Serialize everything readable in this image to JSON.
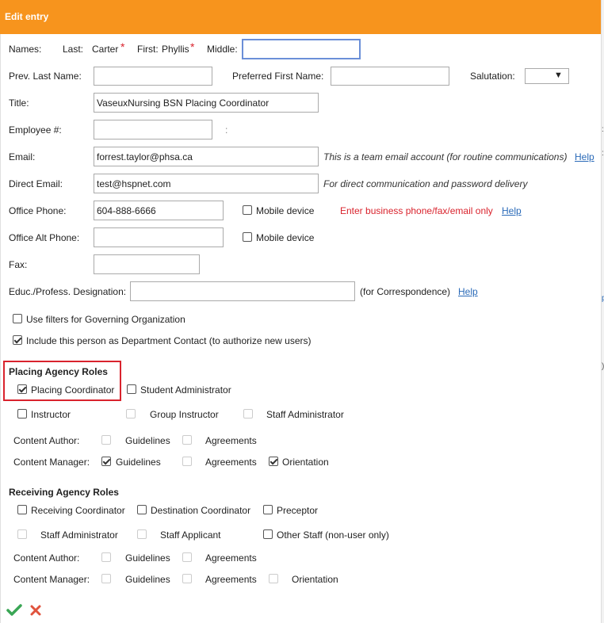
{
  "window": {
    "title": "Edit entry"
  },
  "names": {
    "label": "Names:",
    "last_label": "Last:",
    "last_value": "Carter",
    "first_label": "First:",
    "first_value": "Phyllis",
    "middle_label": "Middle:",
    "middle_value": ""
  },
  "prev_last_name": {
    "label": "Prev. Last Name:",
    "value": ""
  },
  "preferred_first_name": {
    "label": "Preferred First Name:",
    "value": ""
  },
  "salutation": {
    "label": "Salutation:",
    "value": ""
  },
  "title_field": {
    "label": "Title:",
    "value": "VaseuxNursing BSN Placing Coordinator"
  },
  "employee": {
    "label": "Employee #:",
    "value": "",
    "separator": ":"
  },
  "email": {
    "label": "Email:",
    "value": "forrest.taylor@phsa.ca",
    "note": "This is a team email account (for routine communications)",
    "help": "Help"
  },
  "direct_email": {
    "label": "Direct Email:",
    "value": "test@hspnet.com",
    "note": "For direct communication and password delivery"
  },
  "office_phone": {
    "label": "Office Phone:",
    "value": "604-888-6666",
    "mobile_label": "Mobile device",
    "warning": "Enter business phone/fax/email only",
    "help": "Help"
  },
  "office_alt_phone": {
    "label": "Office Alt Phone:",
    "value": "",
    "mobile_label": "Mobile device"
  },
  "fax": {
    "label": "Fax:",
    "value": ""
  },
  "designation": {
    "label": "Educ./Profess. Designation:",
    "value": "",
    "note": "(for Correspondence)",
    "help": "Help"
  },
  "options": {
    "use_filters": "Use filters for Governing Organization",
    "department_contact": "Include this person as Department Contact (to authorize new users)"
  },
  "placing_roles": {
    "heading": "Placing Agency Roles",
    "placing_coordinator": "Placing Coordinator",
    "student_administrator": "Student Administrator",
    "instructor": "Instructor",
    "group_instructor": "Group Instructor",
    "staff_administrator": "Staff Administrator",
    "content_author_label": "Content Author:",
    "content_manager_label": "Content Manager:",
    "guidelines": "Guidelines",
    "agreements": "Agreements",
    "orientation": "Orientation"
  },
  "receiving_roles": {
    "heading": "Receiving Agency Roles",
    "receiving_coordinator": "Receiving Coordinator",
    "destination_coordinator": "Destination Coordinator",
    "preceptor": "Preceptor",
    "staff_administrator": "Staff Administrator",
    "staff_applicant": "Staff Applicant",
    "other_staff": "Other Staff (non-user only)",
    "content_author_label": "Content Author:",
    "content_manager_label": "Content Manager:",
    "guidelines": "Guidelines",
    "agreements": "Agreements",
    "orientation": "Orientation"
  },
  "colors": {
    "title_bar": "#f7941d",
    "required": "#d9232d",
    "link": "#2a6ab8",
    "ok": "#3aa655",
    "cancel": "#e0533d"
  },
  "icons": {
    "save": "checkmark-icon",
    "cancel": "x-icon",
    "dropdown": "triangle-down-icon"
  }
}
